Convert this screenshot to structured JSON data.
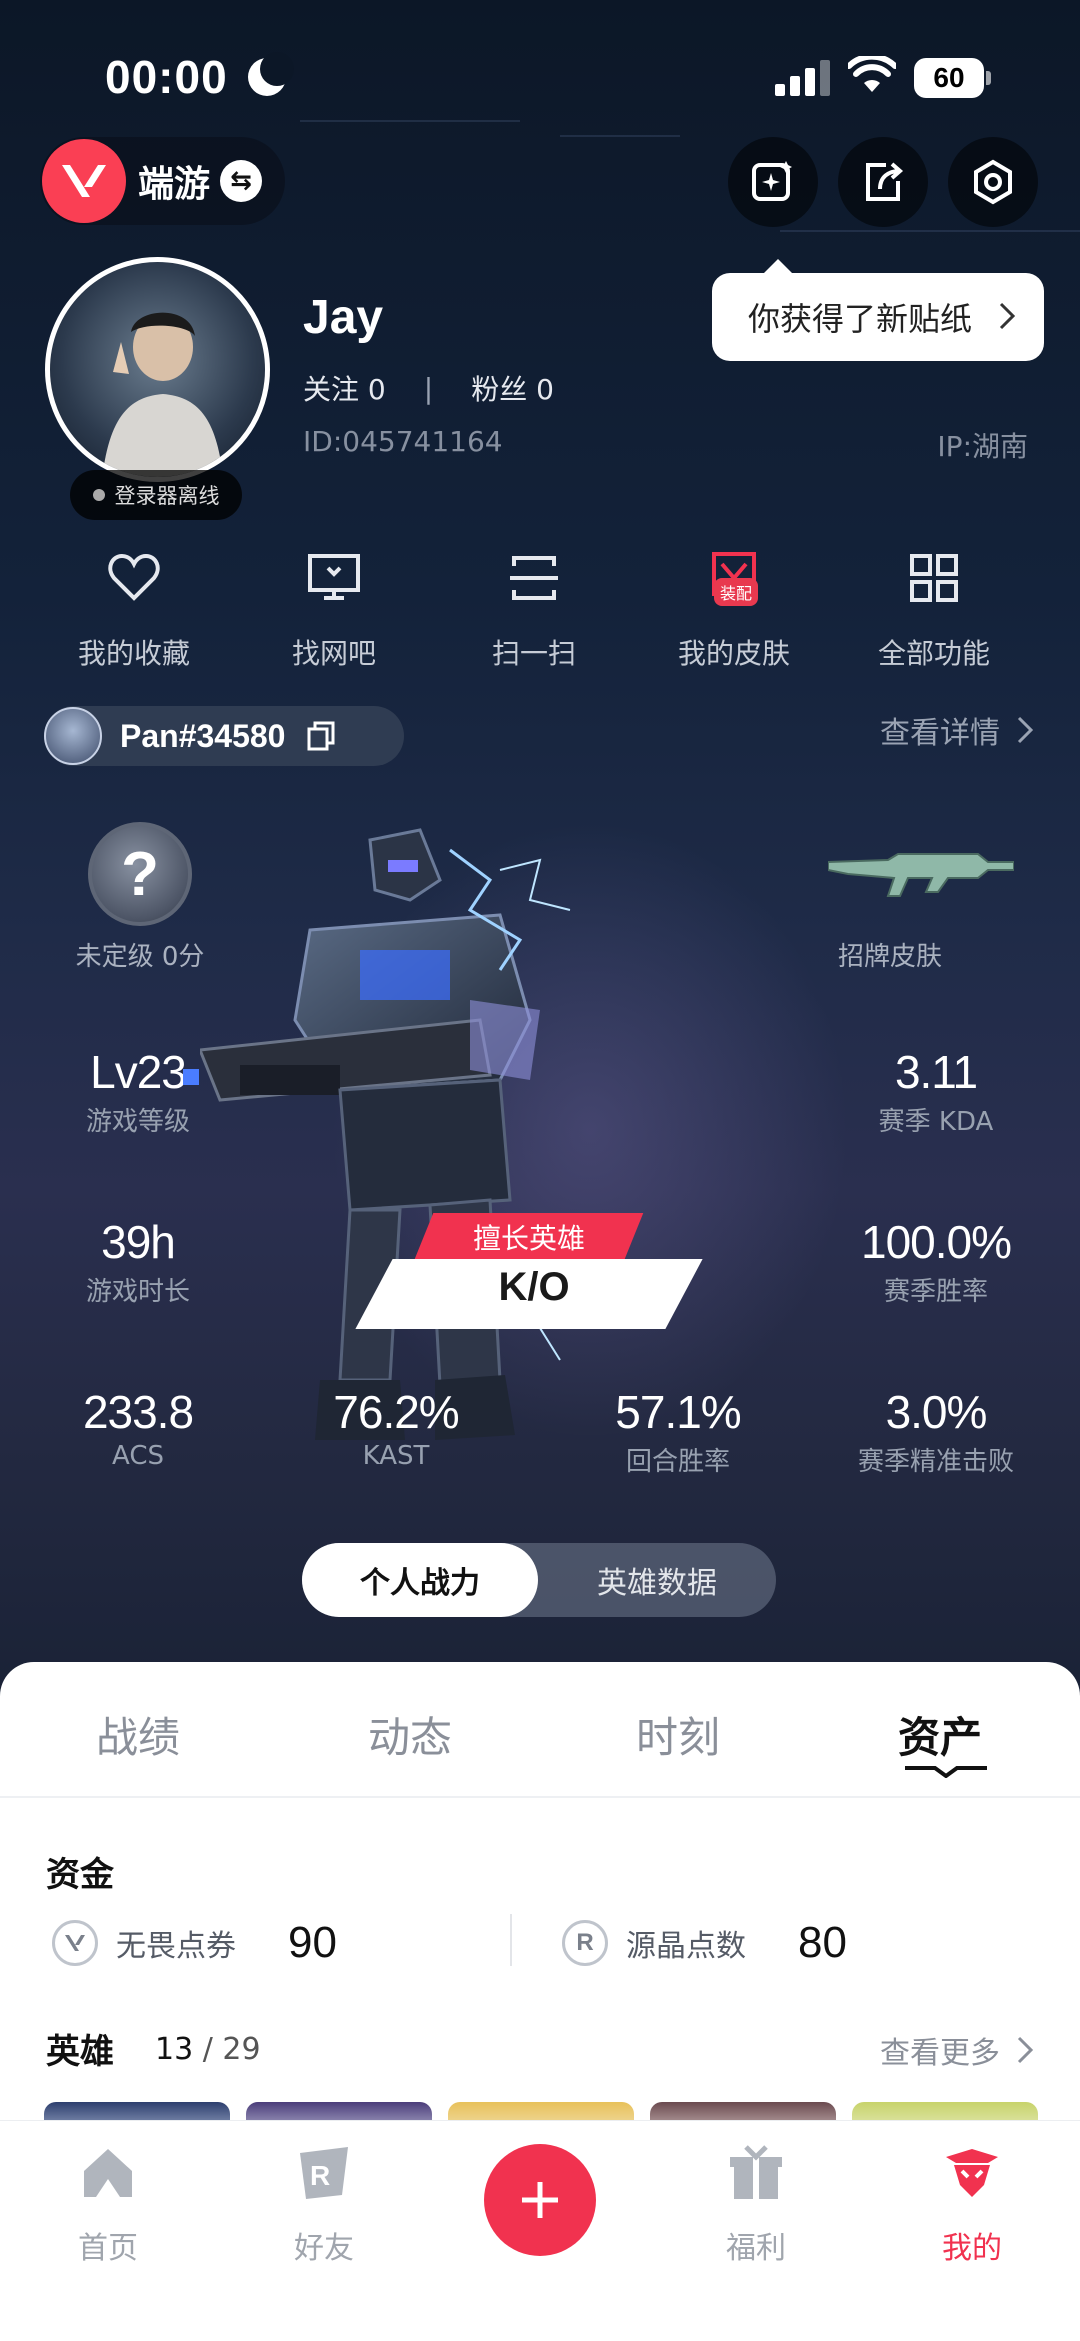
{
  "status_bar": {
    "time": "00:00",
    "battery": "60"
  },
  "top_bar": {
    "game_label": "端游"
  },
  "toast": {
    "text": "你获得了新贴纸"
  },
  "profile": {
    "name": "Jay",
    "follow_label": "关注",
    "follow_count": "0",
    "fans_label": "粉丝",
    "fans_count": "0",
    "id_text": "ID:045741164",
    "ip_text": "IP:湖南",
    "status": "登录器离线"
  },
  "quick_actions": [
    {
      "label": "我的收藏",
      "icon": "heart-icon"
    },
    {
      "label": "找网吧",
      "icon": "monitor-icon"
    },
    {
      "label": "扫一扫",
      "icon": "scan-icon"
    },
    {
      "label": "我的皮肤",
      "icon": "skin-icon",
      "tag": "装配"
    },
    {
      "label": "全部功能",
      "icon": "grid-icon"
    }
  ],
  "account": {
    "name": "Pan#34580",
    "details": "查看详情"
  },
  "stats": {
    "rank": {
      "value": "?",
      "label": "未定级 0分"
    },
    "signature_skin": {
      "label": "招牌皮肤",
      "icon": "rifle-icon"
    },
    "level": {
      "value": "Lv23",
      "label": "游戏等级"
    },
    "kda": {
      "value": "3.11",
      "label": "赛季 KDA"
    },
    "playtime": {
      "value": "39h",
      "label": "游戏时长"
    },
    "win_rate": {
      "value": "100.0%",
      "label": "赛季胜率"
    },
    "acs": {
      "value": "233.8",
      "label": "ACS"
    },
    "kast": {
      "value": "76.2%",
      "label": "KAST"
    },
    "round_win": {
      "value": "57.1%",
      "label": "回合胜率"
    },
    "headshot": {
      "value": "3.0%",
      "label": "赛季精准击败"
    }
  },
  "best_hero": {
    "tag": "擅长英雄",
    "name": "K/O"
  },
  "segment": {
    "active": "个人战力",
    "inactive": "英雄数据"
  },
  "tabs": [
    "战绩",
    "动态",
    "时刻",
    "资产"
  ],
  "assets": {
    "funds_title": "资金",
    "vp_label": "无畏点券",
    "vp_value": "90",
    "rp_label": "源晶点数",
    "rp_value": "80",
    "heroes_title": "英雄",
    "heroes_owned": "13",
    "heroes_sep": " / ",
    "heroes_total": "29",
    "more": "查看更多"
  },
  "nav": [
    {
      "label": "首页",
      "icon": "home-icon"
    },
    {
      "label": "好友",
      "icon": "friends-icon"
    },
    {
      "label": "福利",
      "icon": "gift-icon"
    },
    {
      "label": "我的",
      "icon": "profile-icon"
    }
  ],
  "colors": {
    "accent": "#f1324f",
    "brand": "#fa3f54",
    "level_dot": "#4a7dff"
  }
}
